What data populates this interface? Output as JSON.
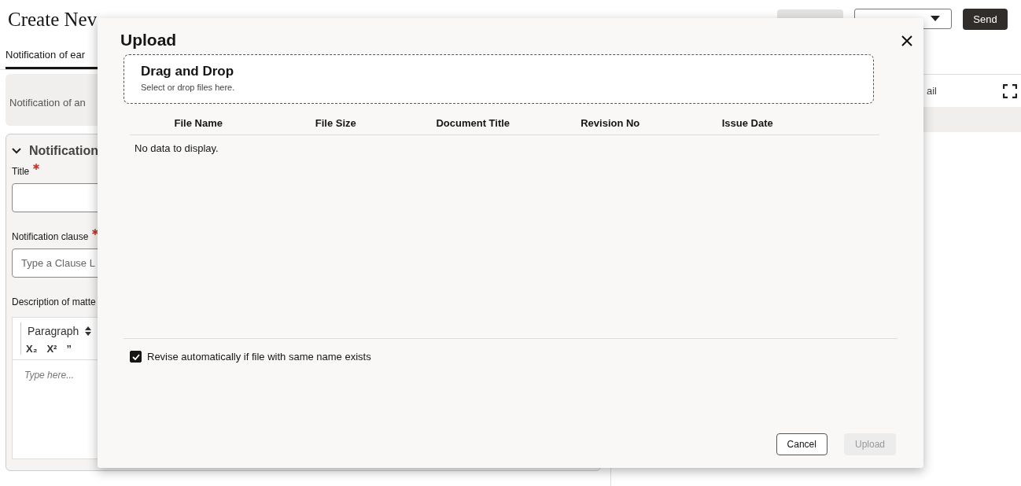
{
  "page": {
    "title": "Create Nev",
    "send_button": "Send"
  },
  "tabs": [
    {
      "label": "Notification of ear",
      "selected": true
    }
  ],
  "summary": "Notification of an",
  "section": {
    "title": "Notification",
    "expanded": true,
    "fields": [
      {
        "kind": "text",
        "label": "Title",
        "required": true
      },
      {
        "kind": "text",
        "label": "Notification clause",
        "required": true,
        "placeholder": "Type a Clause L"
      },
      {
        "kind": "editor",
        "label": "Description of matte",
        "format": "Paragraph",
        "tools": [
          "X₂",
          "X²",
          "”"
        ],
        "placeholder": "Type here..."
      }
    ]
  },
  "side_panel": {
    "tab": "ail"
  },
  "dialog": {
    "title": "Upload",
    "dropzone": {
      "title": "Drag and Drop",
      "hint": "Select or drop files here."
    },
    "columns": [
      "File Name",
      "File Size",
      "Document Title",
      "Revision No",
      "Issue Date"
    ],
    "empty_text": "No data to display.",
    "option": {
      "label": "Revise automatically if file with same name exists",
      "checked": true
    },
    "buttons": [
      {
        "label": "Cancel",
        "disabled": false
      },
      {
        "label": "Upload",
        "disabled": true
      }
    ]
  }
}
